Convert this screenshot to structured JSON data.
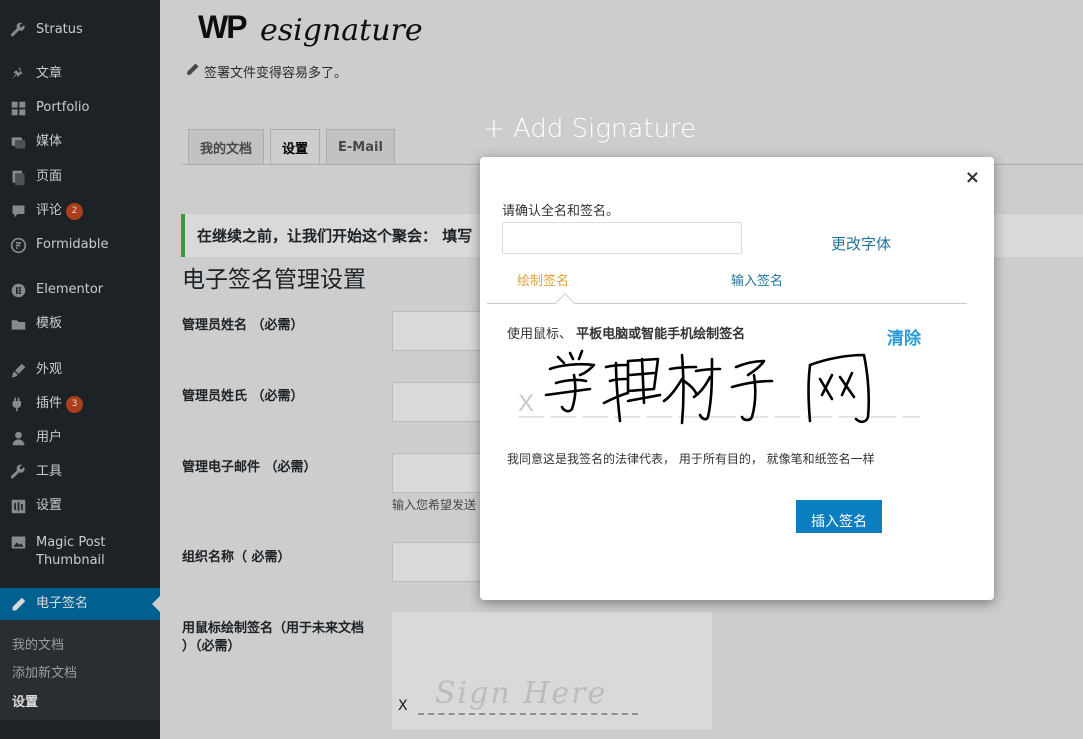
{
  "sidebar": {
    "items": [
      {
        "label": "Stratus",
        "icon": "wrench-icon"
      },
      {
        "label": "文章",
        "icon": "pin-icon"
      },
      {
        "label": "Portfolio",
        "icon": "grid-icon"
      },
      {
        "label": "媒体",
        "icon": "media-icon"
      },
      {
        "label": "页面",
        "icon": "page-icon"
      },
      {
        "label": "评论",
        "icon": "comment-icon",
        "badge": "2"
      },
      {
        "label": "Formidable",
        "icon": "formidable-icon"
      },
      {
        "label": "Elementor",
        "icon": "elementor-icon"
      },
      {
        "label": "模板",
        "icon": "folder-icon"
      },
      {
        "label": "外观",
        "icon": "brush-icon"
      },
      {
        "label": "插件",
        "icon": "plugin-icon",
        "badge": "3"
      },
      {
        "label": "用户",
        "icon": "user-icon"
      },
      {
        "label": "工具",
        "icon": "tools-icon"
      },
      {
        "label": "设置",
        "icon": "settings-icon"
      },
      {
        "label": "Magic Post Thumbnail",
        "icon": "image-icon"
      },
      {
        "label": "电子签名",
        "icon": "pen-icon",
        "active": true
      }
    ],
    "submenu": [
      "我的文档",
      "添加新文档",
      "设置"
    ],
    "submenu_current": "设置"
  },
  "header": {
    "logo_wp": "WP",
    "logo_script": "esignature",
    "tagline": "签署文件变得容易多了。"
  },
  "tabs": [
    "我的文档",
    "设置",
    "E-Mail"
  ],
  "active_tab": "设置",
  "notice": "在继续之前，让我们开始这个聚会： 填写",
  "settings": {
    "title": "电子签名管理设置",
    "fields": [
      {
        "label": "管理员姓名 （必需）"
      },
      {
        "label": "管理员姓氏 （必需）"
      },
      {
        "label": "管理电子邮件 （必需）",
        "hint": "输入您希望发送"
      },
      {
        "label": "组织名称（ 必需）"
      },
      {
        "label": "用鼠标绘制签名（用于未来文档 ）（必需）"
      }
    ],
    "sign_here": "Sign Here",
    "sign_x": "X"
  },
  "modal": {
    "heading": "+ Add Signature",
    "close": "×",
    "name_label": "请确认全名和签名。",
    "name_value": "",
    "change_font": "更改字体",
    "tab_draw": "绘制签名",
    "tab_type": "输入签名",
    "draw_hint_prefix": "使用鼠标、 ",
    "draw_hint_bold": "平板电脑或智能手机绘制签名",
    "clear": "清除",
    "pad_x": "X",
    "agree": "我同意这是我签名的法律代表， 用于所有目的， 就像笔和纸签名一样",
    "insert_button": "插入签名"
  },
  "colors": {
    "sidebar_bg": "#23282d",
    "active_menu": "#0073aa",
    "notice_border": "#46b450",
    "insert_button": "#0b7dc1",
    "tab_draw_active": "#e0a23c"
  }
}
